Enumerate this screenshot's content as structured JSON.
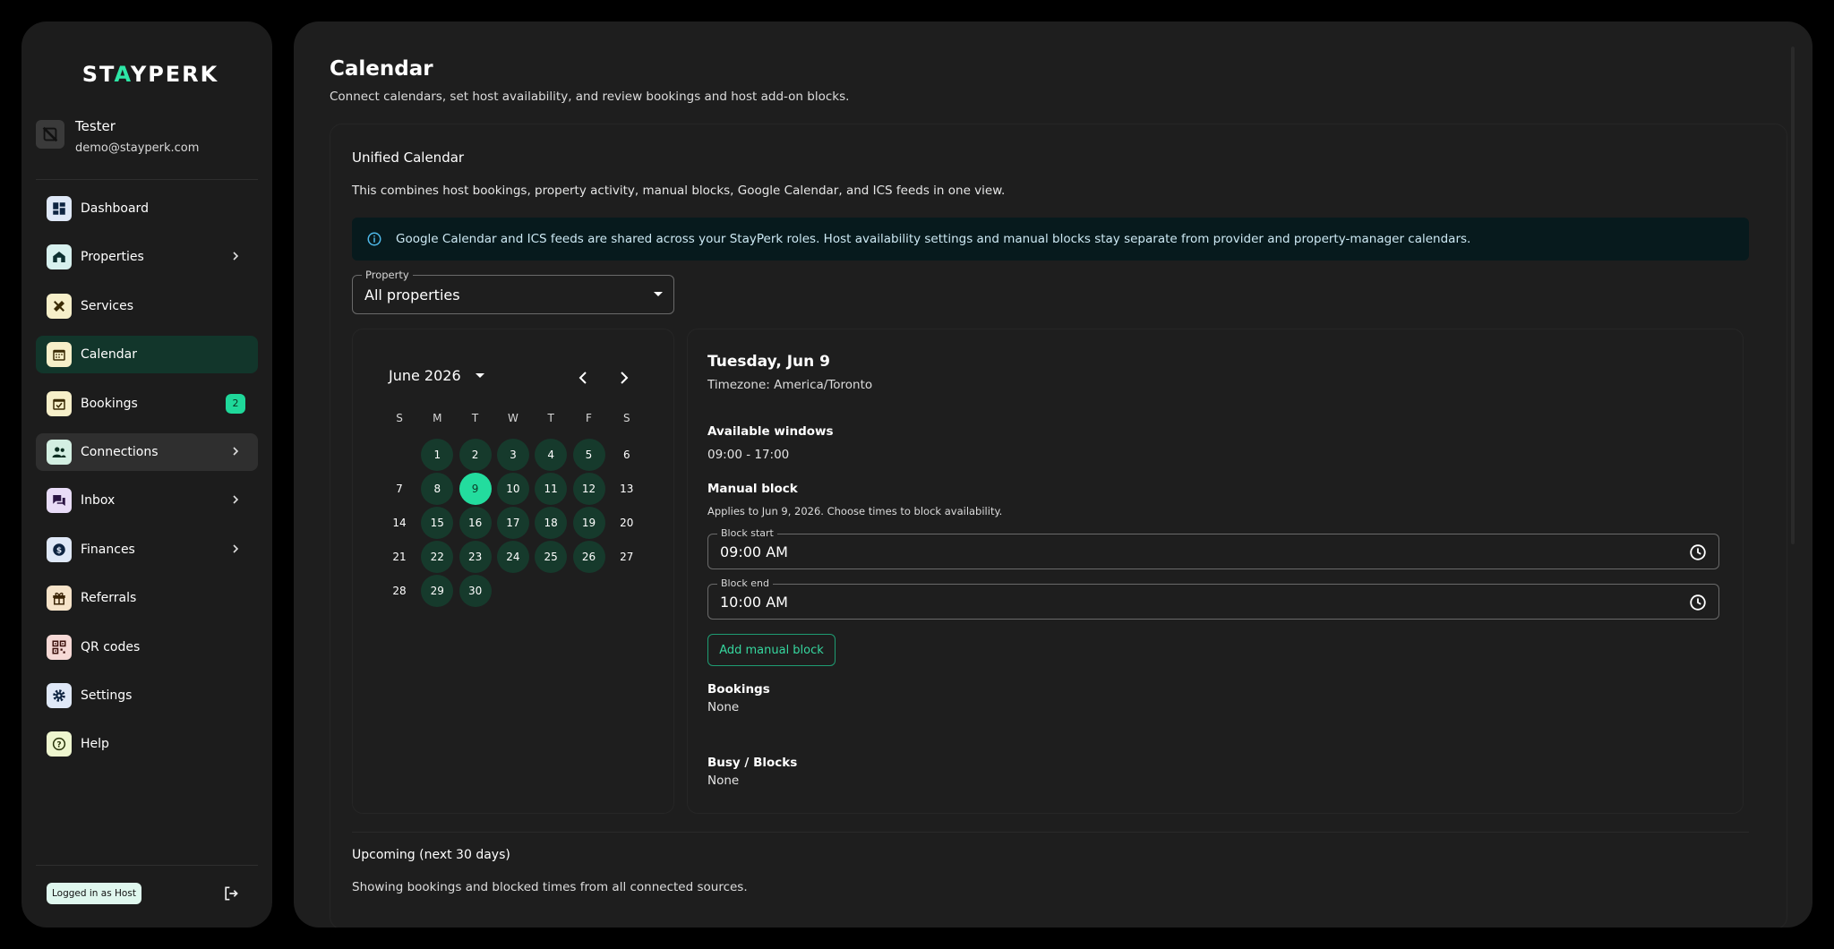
{
  "brand": {
    "logo_prefix": "ST",
    "logo_accent": "A",
    "logo_suffix": "YPERK",
    "accent_color": "#2ee6a6"
  },
  "user": {
    "name": "Tester",
    "email": "demo@stayperk.com"
  },
  "sidebar": {
    "items": [
      {
        "label": "Dashboard",
        "icon": "dashboard-icon"
      },
      {
        "label": "Properties",
        "icon": "home-icon",
        "chevron": true
      },
      {
        "label": "Services",
        "icon": "tools-icon"
      },
      {
        "label": "Calendar",
        "icon": "calendar-icon",
        "active": true
      },
      {
        "label": "Bookings",
        "icon": "booking-icon",
        "badge": "2"
      },
      {
        "label": "Connections",
        "icon": "people-icon",
        "chevron": true,
        "hover": true
      },
      {
        "label": "Inbox",
        "icon": "chat-icon",
        "chevron": true
      },
      {
        "label": "Finances",
        "icon": "dollar-icon",
        "chevron": true
      },
      {
        "label": "Referrals",
        "icon": "gift-icon"
      },
      {
        "label": "QR codes",
        "icon": "qr-icon"
      },
      {
        "label": "Settings",
        "icon": "gear-icon"
      },
      {
        "label": "Help",
        "icon": "help-icon"
      }
    ],
    "role_label": "Logged in as Host"
  },
  "page": {
    "title": "Calendar",
    "subtitle": "Connect calendars, set host availability, and review bookings and host add-on blocks."
  },
  "unified": {
    "title": "Unified Calendar",
    "description": "This combines host bookings, property activity, manual blocks, Google Calendar, and ICS feeds in one view.",
    "alert": "Google Calendar and ICS feeds are shared across your StayPerk roles. Host availability settings and manual blocks stay separate from provider and property-manager calendars."
  },
  "property_select": {
    "label": "Property",
    "value": "All properties"
  },
  "calendar": {
    "month_label": "June 2026",
    "weekdays": [
      "S",
      "M",
      "T",
      "W",
      "T",
      "F",
      "S"
    ],
    "start_offset": 1,
    "days_in_month": 30,
    "selected_day": 9,
    "unavailable_days": [
      6,
      7,
      13,
      14,
      20,
      21,
      27,
      28
    ]
  },
  "day_detail": {
    "title": "Tuesday, Jun 9",
    "timezone": "Timezone: America/Toronto",
    "available_label": "Available windows",
    "available_value": "09:00 - 17:00",
    "manual_block_label": "Manual block",
    "manual_block_hint": "Applies to Jun 9, 2026. Choose times to block availability.",
    "block_start_label": "Block start",
    "block_start_value": "09:00 AM",
    "block_end_label": "Block end",
    "block_end_value": "10:00 AM",
    "add_button": "Add manual block",
    "bookings_label": "Bookings",
    "bookings_value": "None",
    "busy_label": "Busy / Blocks",
    "busy_value": "None"
  },
  "upcoming": {
    "title": "Upcoming (next 30 days)",
    "description": "Showing bookings and blocked times from all connected sources."
  }
}
